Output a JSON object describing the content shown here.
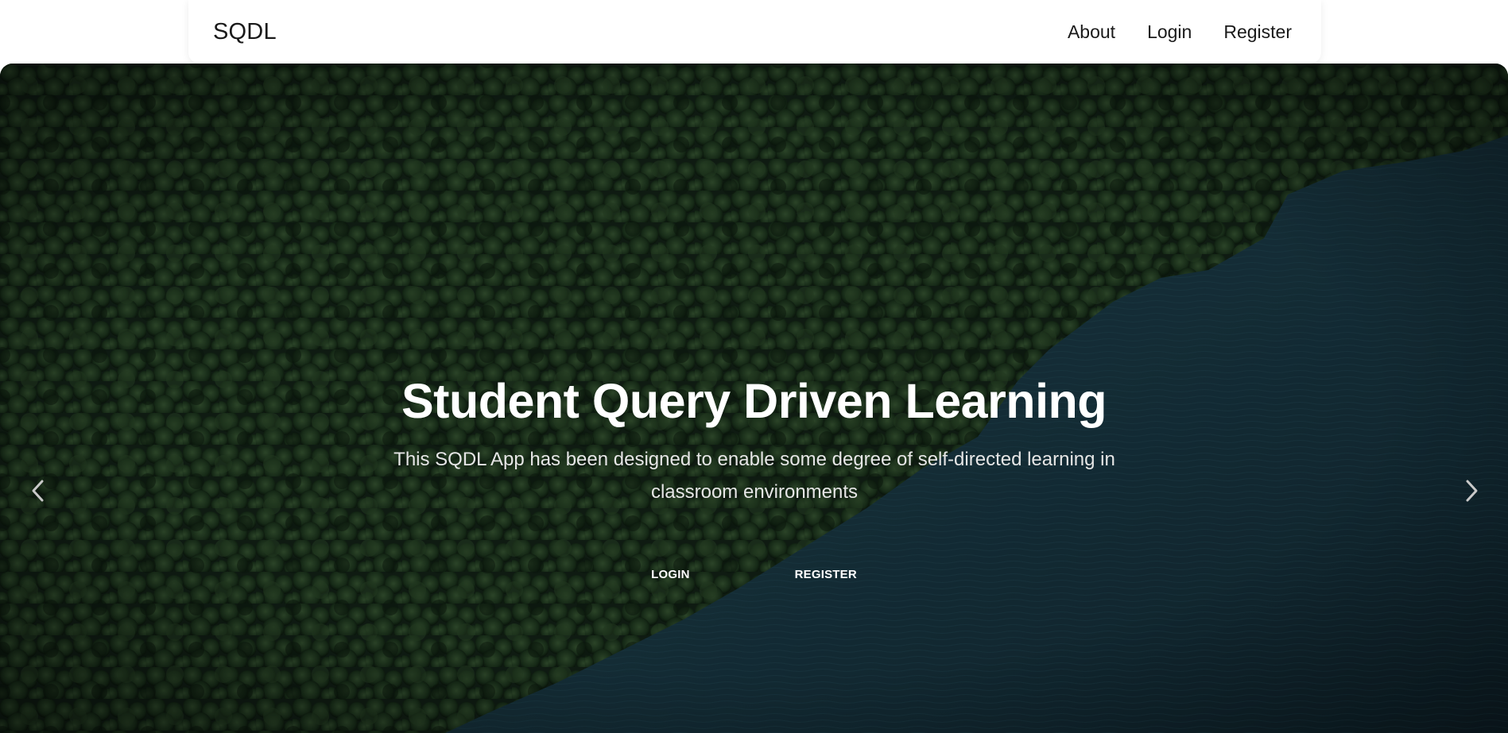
{
  "navbar": {
    "brand": "SQDL",
    "links": [
      "About",
      "Login",
      "Register"
    ]
  },
  "hero": {
    "title": "Student Query Driven Learning",
    "subtitle": "This SQDL App has been designed to enable some degree of self-directed learning in classroom environments",
    "buttons": [
      "LOGIN",
      "REGISTER"
    ],
    "background": "aerial-forest-lake-photo",
    "prev_icon": "chevron-left-icon",
    "next_icon": "chevron-right-icon"
  },
  "colors": {
    "navbar_bg": "#ffffff",
    "forest": "#1f3520",
    "lake": "#1c3a47",
    "text_light": "#ffffff"
  }
}
